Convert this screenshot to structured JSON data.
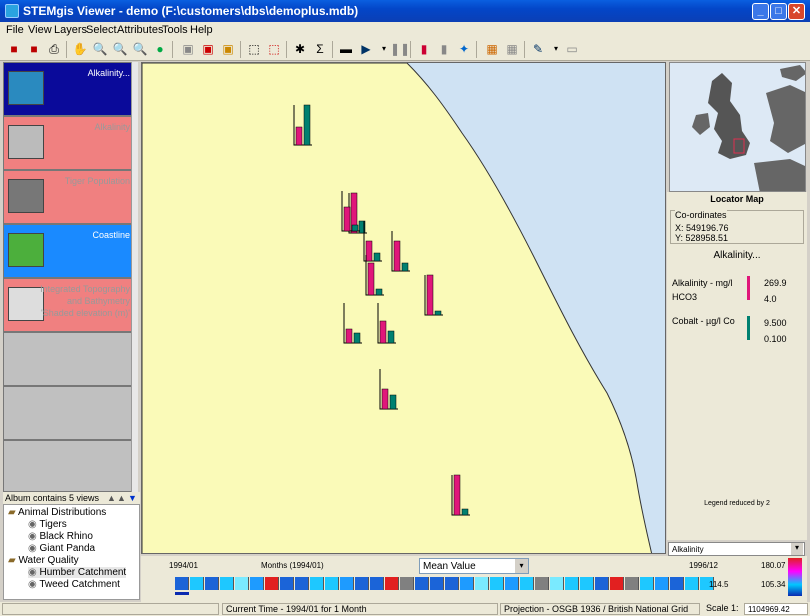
{
  "window": {
    "title": "STEMgis Viewer - demo (F:\\customers\\dbs\\demoplus.mdb)"
  },
  "menu": [
    "File",
    "View",
    "Layers",
    "Select",
    "Attributes",
    "Tools",
    "Help"
  ],
  "album": {
    "views": [
      {
        "label": "Alkalinity...",
        "state": "selected"
      },
      {
        "label": "Alkalinity",
        "state": "inactive"
      },
      {
        "label": "Tiger Population",
        "state": "inactive"
      },
      {
        "label": "Coastline",
        "state": "active"
      },
      {
        "label": "Integrated Topography and Bathymetry 'Shaded elevation (m)'",
        "state": "inactive"
      }
    ],
    "status": "Album contains 5 views",
    "tree": [
      {
        "label": "Animal Distributions",
        "level": 0
      },
      {
        "label": "Tigers",
        "level": 1
      },
      {
        "label": "Black Rhino",
        "level": 1
      },
      {
        "label": "Giant Panda",
        "level": 1
      },
      {
        "label": "Water Quality",
        "level": 0
      },
      {
        "label": "Humber Catchment",
        "level": 1
      },
      {
        "label": "Tweed Catchment",
        "level": 1
      }
    ]
  },
  "map": {
    "bar_groups": [
      {
        "alkalinity": 0.45,
        "cobalt": 1.0
      },
      {
        "alkalinity": 1.0,
        "cobalt": 0.3
      },
      {
        "alkalinity": 0.6,
        "cobalt": 0.15
      },
      {
        "alkalinity": 0.5,
        "cobalt": 0.2
      },
      {
        "alkalinity": 0.75,
        "cobalt": 0.2
      },
      {
        "alkalinity": 0.8,
        "cobalt": 0.15
      },
      {
        "alkalinity": 1.0,
        "cobalt": 0.1
      },
      {
        "alkalinity": 0.35,
        "cobalt": 0.25
      },
      {
        "alkalinity": 0.55,
        "cobalt": 0.3
      },
      {
        "alkalinity": 0.5,
        "cobalt": 0.35
      },
      {
        "alkalinity": 1.0,
        "cobalt": 0.15
      }
    ]
  },
  "locator": {
    "title": "Locator Map",
    "coords_title": "Co-ordinates",
    "x": "X: 549196.76",
    "y": "Y: 528958.51"
  },
  "legend": {
    "title": "Alkalinity...",
    "items": [
      {
        "name": "Alkalinity - mg/l HCO3",
        "max": "269.9",
        "min": "4.0",
        "color": "#e0167a"
      },
      {
        "name": "Cobalt - µg/l Co",
        "max": "9.500",
        "min": "0.100",
        "color": "#008070"
      }
    ],
    "note": "Legend reduced by 2",
    "select_value": "Alkalinity"
  },
  "timeline": {
    "start": "1994/01",
    "unit": "Months (1994/01)",
    "stat_select": "Mean Value",
    "end": "1996/12",
    "scale_max": "180.07",
    "val_a": "114.5",
    "val_b": "105.34",
    "cells": [
      "#1b64d8",
      "#1ec8ff",
      "#1b64d8",
      "#1ec8ff",
      "#7aeaff",
      "#1e9bff",
      "#e22020",
      "#1b64d8",
      "#1b64d8",
      "#1ec8ff",
      "#1ec8ff",
      "#1e9bff",
      "#1b64d8",
      "#1b64d8",
      "#e22020",
      "#808080",
      "#1b64d8",
      "#1b64d8",
      "#1b64d8",
      "#1e9bff",
      "#7aeaff",
      "#1ec8ff",
      "#1e9bff",
      "#1ec8ff",
      "#808080",
      "#7aeaff",
      "#1ec8ff",
      "#1ec8ff",
      "#1b64d8",
      "#e22020",
      "#808080",
      "#1ec8ff",
      "#1e9bff",
      "#1b64d8",
      "#1ec8ff",
      "#1ec8ff"
    ]
  },
  "status": {
    "time": "Current Time - 1994/01 for 1 Month",
    "projection": "Projection - OSGB 1936 / British National Grid",
    "scale_label": "Scale 1:",
    "scale_value": "1104969.42"
  }
}
